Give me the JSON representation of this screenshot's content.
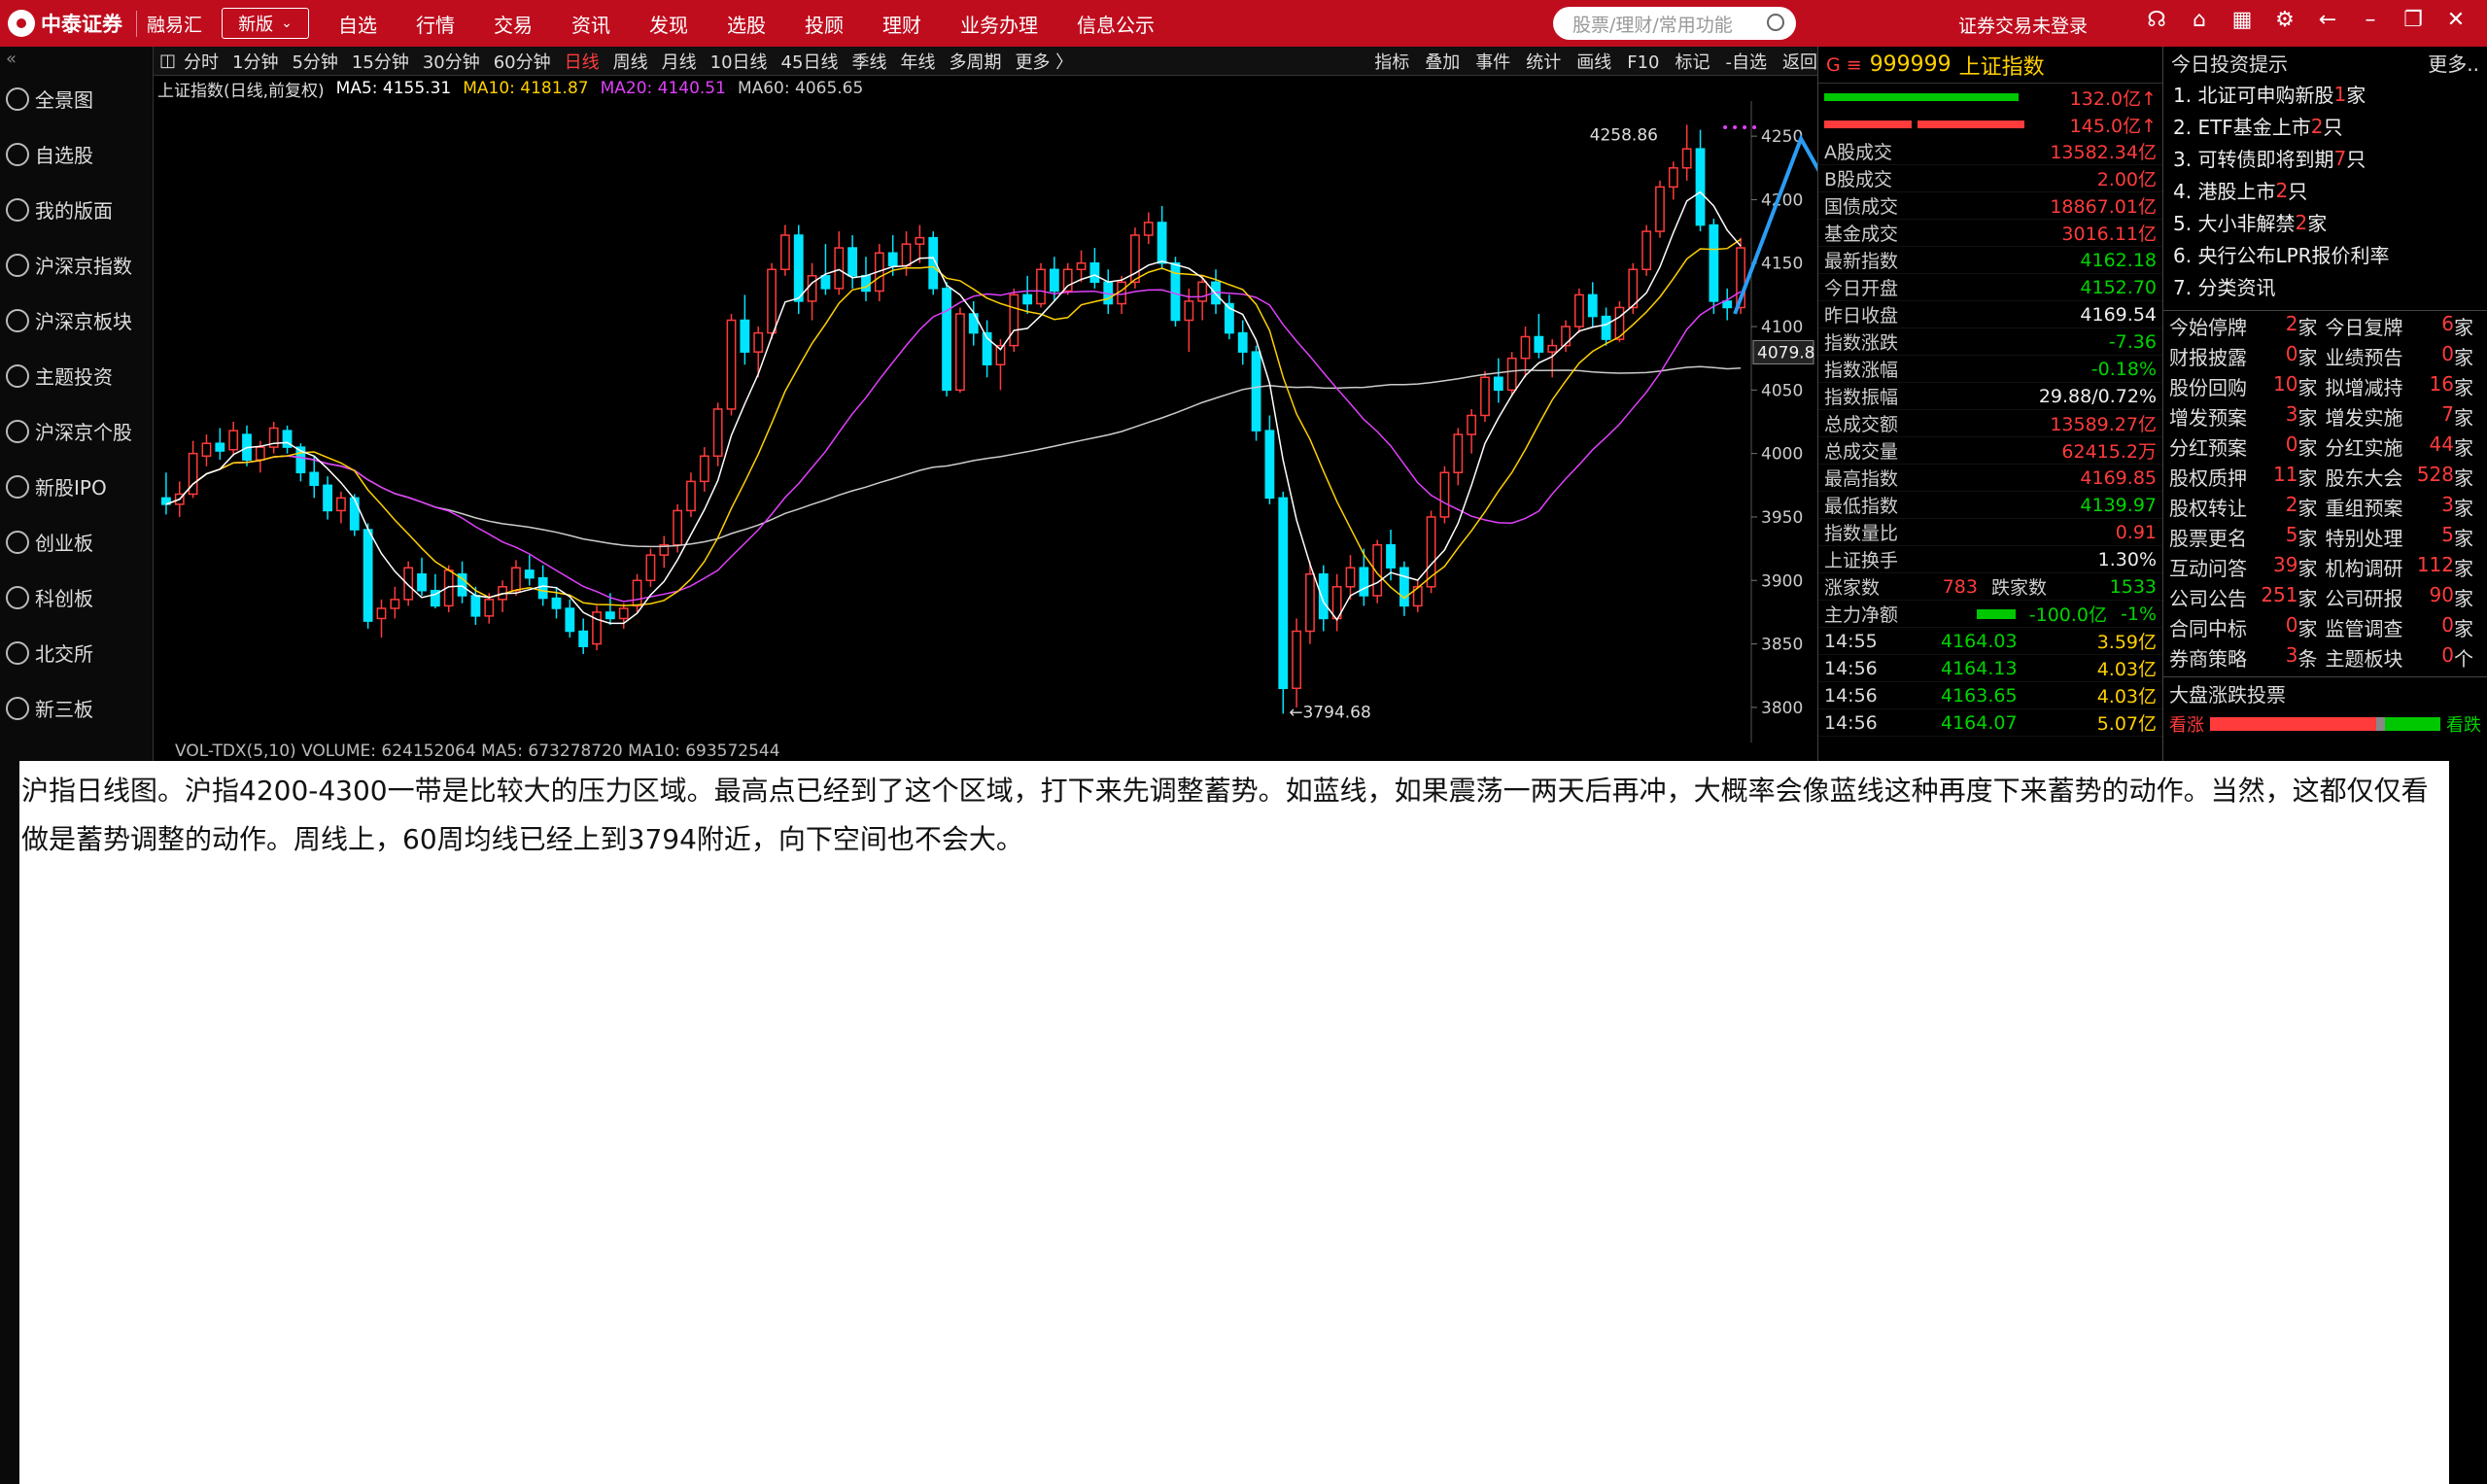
{
  "topbar": {
    "logo_text": "中泰证券",
    "brand2": "融易汇",
    "version": "新版",
    "nav": [
      "自选",
      "行情",
      "交易",
      "资讯",
      "发现",
      "选股",
      "投顾",
      "理财",
      "业务办理",
      "信息公示"
    ],
    "search_placeholder": "股票/理财/常用功能",
    "login_status": "证券交易未登录"
  },
  "sidebar": {
    "items": [
      "全景图",
      "自选股",
      "我的版面",
      "沪深京指数",
      "沪深京板块",
      "主题投资",
      "沪深京个股",
      "新股IPO",
      "创业板",
      "科创板",
      "北交所",
      "新三板"
    ]
  },
  "toolbar": {
    "periods": [
      "分时",
      "1分钟",
      "5分钟",
      "15分钟",
      "30分钟",
      "60分钟",
      "日线",
      "周线",
      "月线",
      "10日线",
      "45日线",
      "季线",
      "年线",
      "多周期",
      "更多 〉"
    ],
    "active_period": "日线",
    "tools": [
      "指标",
      "叠加",
      "事件",
      "统计",
      "画线",
      "F10",
      "标记",
      "-自选",
      "返回"
    ]
  },
  "legend": {
    "title": "上证指数(日线,前复权)",
    "ma5": "MA5: 4155.31",
    "ma10": "MA10: 4181.87",
    "ma20": "MA20: 4140.51",
    "ma60": "MA60: 4065.65"
  },
  "chart_data": {
    "type": "candlestick",
    "ylim": [
      3780,
      4270
    ],
    "yticks": [
      3800,
      3850,
      3900,
      3950,
      4000,
      4050,
      4100,
      4150,
      4200,
      4250
    ],
    "current_price_label": "4079.8",
    "high_label": "4258.86",
    "low_label": "3794.68",
    "colors": {
      "up": "#ff3b3b",
      "down": "#00e5ff",
      "ma5": "#ffffff",
      "ma10": "#ffd000",
      "ma20": "#e040fb",
      "ma60": "#cccccc",
      "annotation": "#2a9df4"
    },
    "candles": [
      [
        3965,
        3985,
        3952,
        3960
      ],
      [
        3960,
        3978,
        3950,
        3968
      ],
      [
        3968,
        4010,
        3965,
        4000
      ],
      [
        3998,
        4015,
        3990,
        4008
      ],
      [
        4008,
        4020,
        3995,
        4002
      ],
      [
        4003,
        4025,
        3998,
        4018
      ],
      [
        4015,
        4022,
        3990,
        3995
      ],
      [
        3995,
        4010,
        3985,
        4005
      ],
      [
        4005,
        4025,
        4000,
        4020
      ],
      [
        4018,
        4022,
        4000,
        4005
      ],
      [
        4005,
        4008,
        3978,
        3985
      ],
      [
        3985,
        3998,
        3965,
        3975
      ],
      [
        3975,
        3982,
        3948,
        3955
      ],
      [
        3955,
        3970,
        3945,
        3965
      ],
      [
        3965,
        3968,
        3935,
        3940
      ],
      [
        3940,
        3945,
        3862,
        3868
      ],
      [
        3870,
        3885,
        3855,
        3878
      ],
      [
        3878,
        3895,
        3870,
        3885
      ],
      [
        3885,
        3915,
        3880,
        3910
      ],
      [
        3905,
        3918,
        3888,
        3892
      ],
      [
        3892,
        3905,
        3878,
        3880
      ],
      [
        3880,
        3912,
        3875,
        3908
      ],
      [
        3905,
        3915,
        3882,
        3888
      ],
      [
        3888,
        3895,
        3865,
        3872
      ],
      [
        3872,
        3890,
        3866,
        3885
      ],
      [
        3885,
        3900,
        3875,
        3895
      ],
      [
        3892,
        3916,
        3888,
        3910
      ],
      [
        3908,
        3920,
        3896,
        3902
      ],
      [
        3902,
        3912,
        3880,
        3886
      ],
      [
        3886,
        3895,
        3870,
        3878
      ],
      [
        3878,
        3885,
        3855,
        3860
      ],
      [
        3860,
        3870,
        3842,
        3848
      ],
      [
        3850,
        3880,
        3845,
        3875
      ],
      [
        3875,
        3890,
        3865,
        3870
      ],
      [
        3870,
        3882,
        3862,
        3878
      ],
      [
        3880,
        3905,
        3875,
        3900
      ],
      [
        3900,
        3925,
        3895,
        3920
      ],
      [
        3920,
        3935,
        3910,
        3928
      ],
      [
        3928,
        3960,
        3922,
        3955
      ],
      [
        3955,
        3985,
        3950,
        3978
      ],
      [
        3978,
        4005,
        3970,
        3998
      ],
      [
        3998,
        4040,
        3990,
        4035
      ],
      [
        4035,
        4110,
        4030,
        4105
      ],
      [
        4105,
        4125,
        4070,
        4080
      ],
      [
        4080,
        4100,
        4060,
        4095
      ],
      [
        4095,
        4150,
        4090,
        4145
      ],
      [
        4145,
        4180,
        4140,
        4172
      ],
      [
        4172,
        4180,
        4110,
        4120
      ],
      [
        4120,
        4150,
        4105,
        4140
      ],
      [
        4140,
        4165,
        4125,
        4130
      ],
      [
        4130,
        4175,
        4125,
        4162
      ],
      [
        4162,
        4172,
        4130,
        4140
      ],
      [
        4140,
        4155,
        4120,
        4128
      ],
      [
        4128,
        4165,
        4120,
        4158
      ],
      [
        4158,
        4172,
        4140,
        4148
      ],
      [
        4148,
        4175,
        4140,
        4165
      ],
      [
        4165,
        4180,
        4150,
        4170
      ],
      [
        4170,
        4175,
        4125,
        4130
      ],
      [
        4130,
        4135,
        4045,
        4050
      ],
      [
        4050,
        4115,
        4048,
        4110
      ],
      [
        4110,
        4120,
        4085,
        4095
      ],
      [
        4095,
        4105,
        4060,
        4070
      ],
      [
        4070,
        4090,
        4050,
        4085
      ],
      [
        4085,
        4130,
        4080,
        4125
      ],
      [
        4125,
        4140,
        4110,
        4118
      ],
      [
        4118,
        4150,
        4115,
        4145
      ],
      [
        4145,
        4155,
        4120,
        4128
      ],
      [
        4128,
        4150,
        4125,
        4145
      ],
      [
        4145,
        4160,
        4135,
        4150
      ],
      [
        4150,
        4162,
        4130,
        4135
      ],
      [
        4135,
        4145,
        4110,
        4118
      ],
      [
        4118,
        4140,
        4110,
        4135
      ],
      [
        4135,
        4178,
        4130,
        4172
      ],
      [
        4172,
        4190,
        4165,
        4182
      ],
      [
        4182,
        4195,
        4145,
        4150
      ],
      [
        4150,
        4155,
        4100,
        4105
      ],
      [
        4105,
        4130,
        4080,
        4120
      ],
      [
        4120,
        4140,
        4105,
        4135
      ],
      [
        4135,
        4145,
        4110,
        4118
      ],
      [
        4118,
        4125,
        4090,
        4095
      ],
      [
        4095,
        4105,
        4070,
        4080
      ],
      [
        4080,
        4085,
        4010,
        4018
      ],
      [
        4018,
        4030,
        3960,
        3965
      ],
      [
        3965,
        3970,
        3795,
        3815
      ],
      [
        3815,
        3870,
        3800,
        3860
      ],
      [
        3860,
        3915,
        3850,
        3905
      ],
      [
        3905,
        3912,
        3860,
        3870
      ],
      [
        3870,
        3905,
        3860,
        3895
      ],
      [
        3895,
        3920,
        3885,
        3910
      ],
      [
        3910,
        3925,
        3880,
        3888
      ],
      [
        3888,
        3932,
        3882,
        3928
      ],
      [
        3928,
        3940,
        3900,
        3910
      ],
      [
        3910,
        3915,
        3872,
        3880
      ],
      [
        3880,
        3900,
        3875,
        3895
      ],
      [
        3895,
        3955,
        3890,
        3950
      ],
      [
        3950,
        3990,
        3945,
        3985
      ],
      [
        3985,
        4020,
        3975,
        4015
      ],
      [
        4015,
        4035,
        4000,
        4030
      ],
      [
        4030,
        4065,
        4025,
        4060
      ],
      [
        4060,
        4075,
        4040,
        4050
      ],
      [
        4050,
        4080,
        4045,
        4075
      ],
      [
        4075,
        4100,
        4060,
        4092
      ],
      [
        4092,
        4110,
        4075,
        4080
      ],
      [
        4080,
        4090,
        4060,
        4085
      ],
      [
        4085,
        4105,
        4080,
        4100
      ],
      [
        4100,
        4130,
        4095,
        4125
      ],
      [
        4125,
        4135,
        4100,
        4108
      ],
      [
        4108,
        4115,
        4085,
        4090
      ],
      [
        4090,
        4120,
        4088,
        4115
      ],
      [
        4115,
        4150,
        4110,
        4145
      ],
      [
        4145,
        4180,
        4140,
        4175
      ],
      [
        4175,
        4215,
        4170,
        4210
      ],
      [
        4210,
        4230,
        4200,
        4225
      ],
      [
        4225,
        4259,
        4215,
        4240
      ],
      [
        4240,
        4255,
        4175,
        4180
      ],
      [
        4180,
        4185,
        4110,
        4120
      ],
      [
        4120,
        4130,
        4105,
        4115
      ],
      [
        4115,
        4170,
        4110,
        4162
      ]
    ]
  },
  "vol_label": "VOL-TDX(5,10)  VOLUME: 624152064  MA5: 673278720  MA10: 693572544",
  "quote": {
    "code": "999999",
    "name": "上证指数",
    "bars": [
      {
        "value": "132.0亿↑"
      },
      {
        "value": "145.0亿↑"
      }
    ],
    "rows": [
      {
        "label": "A股成交",
        "value": "13582.34亿",
        "color": "red"
      },
      {
        "label": "B股成交",
        "value": "2.00亿",
        "color": "red"
      },
      {
        "label": "国债成交",
        "value": "18867.01亿",
        "color": "red"
      },
      {
        "label": "基金成交",
        "value": "3016.11亿",
        "color": "red"
      },
      {
        "label": "最新指数",
        "value": "4162.18",
        "color": "green"
      },
      {
        "label": "今日开盘",
        "value": "4152.70",
        "color": "green"
      },
      {
        "label": "昨日收盘",
        "value": "4169.54",
        "color": "white"
      },
      {
        "label": "指数涨跌",
        "value": "-7.36",
        "color": "green"
      },
      {
        "label": "指数涨幅",
        "value": "-0.18%",
        "color": "green"
      },
      {
        "label": "指数振幅",
        "value": "29.88/0.72%",
        "color": "white"
      },
      {
        "label": "总成交额",
        "value": "13589.27亿",
        "color": "red"
      },
      {
        "label": "总成交量",
        "value": "62415.2万",
        "color": "red"
      },
      {
        "label": "最高指数",
        "value": "4169.85",
        "color": "red"
      },
      {
        "label": "最低指数",
        "value": "4139.97",
        "color": "green"
      },
      {
        "label": "指数量比",
        "value": "0.91",
        "color": "red"
      },
      {
        "label": "上证换手",
        "value": "1.30%",
        "color": "white"
      }
    ],
    "updown": {
      "up_label": "涨家数",
      "up": "783",
      "down_label": "跌家数",
      "down": "1533"
    },
    "netflow": {
      "label": "主力净额",
      "value": "-100.0亿",
      "pct": "-1%"
    },
    "ticks": [
      {
        "t": "14:55",
        "p": "4164.03",
        "v": "3.59亿"
      },
      {
        "t": "14:56",
        "p": "4164.13",
        "v": "4.03亿"
      },
      {
        "t": "14:56",
        "p": "4163.65",
        "v": "4.03亿"
      },
      {
        "t": "14:56",
        "p": "4164.07",
        "v": "5.07亿"
      }
    ]
  },
  "notices": {
    "title": "今日投资提示",
    "more": "更多..",
    "tips": [
      {
        "pre": "1. 北证可申购新股",
        "n": "1",
        "post": "家"
      },
      {
        "pre": "2. ETF基金上市",
        "n": "2",
        "post": "只"
      },
      {
        "pre": "3. 可转债即将到期",
        "n": "7",
        "post": "只"
      },
      {
        "pre": "4. 港股上市",
        "n": "2",
        "post": "只"
      },
      {
        "pre": "5. 大小非解禁",
        "n": "2",
        "post": "家"
      },
      {
        "pre": "6. 央行公布LPR报价利率",
        "n": "",
        "post": ""
      },
      {
        "pre": "7. 分类资讯",
        "n": "",
        "post": ""
      }
    ],
    "grid": [
      [
        {
          "k": "今始停牌",
          "n": "2",
          "u": "家"
        },
        {
          "k": "今日复牌",
          "n": "6",
          "u": "家"
        }
      ],
      [
        {
          "k": "财报披露",
          "n": "0",
          "u": "家"
        },
        {
          "k": "业绩预告",
          "n": "0",
          "u": "家"
        }
      ],
      [
        {
          "k": "股份回购",
          "n": "10",
          "u": "家"
        },
        {
          "k": "拟增减持",
          "n": "16",
          "u": "家"
        }
      ],
      [
        {
          "k": "增发预案",
          "n": "3",
          "u": "家"
        },
        {
          "k": "增发实施",
          "n": "7",
          "u": "家"
        }
      ],
      [
        {
          "k": "分红预案",
          "n": "0",
          "u": "家"
        },
        {
          "k": "分红实施",
          "n": "44",
          "u": "家"
        }
      ],
      [
        {
          "k": "股权质押",
          "n": "11",
          "u": "家"
        },
        {
          "k": "股东大会",
          "n": "528",
          "u": "家"
        }
      ],
      [
        {
          "k": "股权转让",
          "n": "2",
          "u": "家"
        },
        {
          "k": "重组预案",
          "n": "3",
          "u": "家"
        }
      ],
      [
        {
          "k": "股票更名",
          "n": "5",
          "u": "家"
        },
        {
          "k": "特别处理",
          "n": "5",
          "u": "家"
        }
      ],
      [
        {
          "k": "互动问答",
          "n": "39",
          "u": "家"
        },
        {
          "k": "机构调研",
          "n": "112",
          "u": "家"
        }
      ],
      [
        {
          "k": "公司公告",
          "n": "251",
          "u": "家"
        },
        {
          "k": "公司研报",
          "n": "90",
          "u": "家"
        }
      ],
      [
        {
          "k": "合同中标",
          "n": "0",
          "u": "家"
        },
        {
          "k": "监管调查",
          "n": "0",
          "u": "家"
        }
      ],
      [
        {
          "k": "券商策略",
          "n": "3",
          "u": "条"
        },
        {
          "k": "主题板块",
          "n": "0",
          "u": "个"
        }
      ]
    ],
    "vote_title": "大盘涨跌投票",
    "vote_up": "看涨",
    "vote_down": "看跌"
  },
  "annotation": {
    "text": "沪指日线图。沪指4200-4300一带是比较大的压力区域。最高点已经到了这个区域，打下来先调整蓄势。如蓝线，如果震荡一两天后再冲，大概率会像蓝线这种再度下来蓄势的动作。当然，这都仅仅看做是蓄势调整的动作。周线上，60周均线已经上到3794附近，向下空间也不会大。"
  }
}
